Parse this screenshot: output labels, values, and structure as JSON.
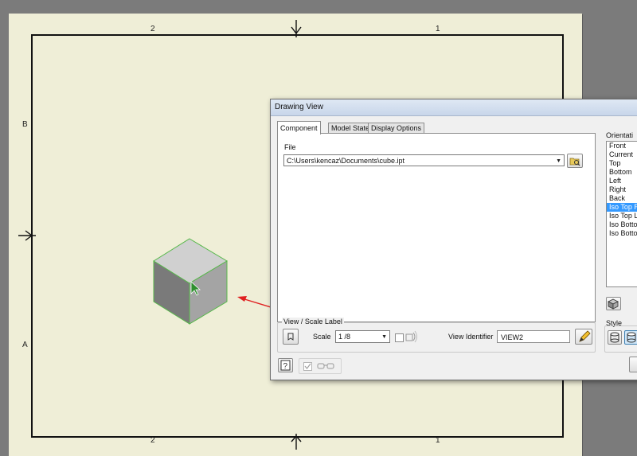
{
  "sheet": {
    "zones_top": [
      "2",
      "1"
    ],
    "zones_bottom": [
      "2",
      "1"
    ],
    "zones_left": [
      "B",
      "A"
    ]
  },
  "dialog": {
    "title": "Drawing View",
    "tabs": [
      {
        "label": "Component",
        "active": true
      },
      {
        "label": "Model State",
        "active": false
      },
      {
        "label": "Display Options",
        "active": false
      }
    ],
    "file_label": "File",
    "file_value": "C:\\Users\\kencaz\\Documents\\cube.ipt",
    "orientation_label": "Orientati",
    "orientation_items": [
      "Front",
      "Current",
      "Top",
      "Bottom",
      "Left",
      "Right",
      "Back",
      "Iso Top R",
      "Iso Top L",
      "Iso Botto",
      "Iso Botto"
    ],
    "orientation_selected": "Iso Top R",
    "view_scale_label": "View / Scale Label",
    "scale_label": "Scale",
    "scale_value": "1 /8",
    "view_identifier_label": "View Identifier",
    "view_identifier_value": "VIEW2",
    "style_label": "Style"
  },
  "colors": {
    "sheet": "#efeed7",
    "background": "#7b7b7b",
    "selection": "#3399ff",
    "arrow": "#e02020",
    "cube_edge": "#57b84a"
  }
}
